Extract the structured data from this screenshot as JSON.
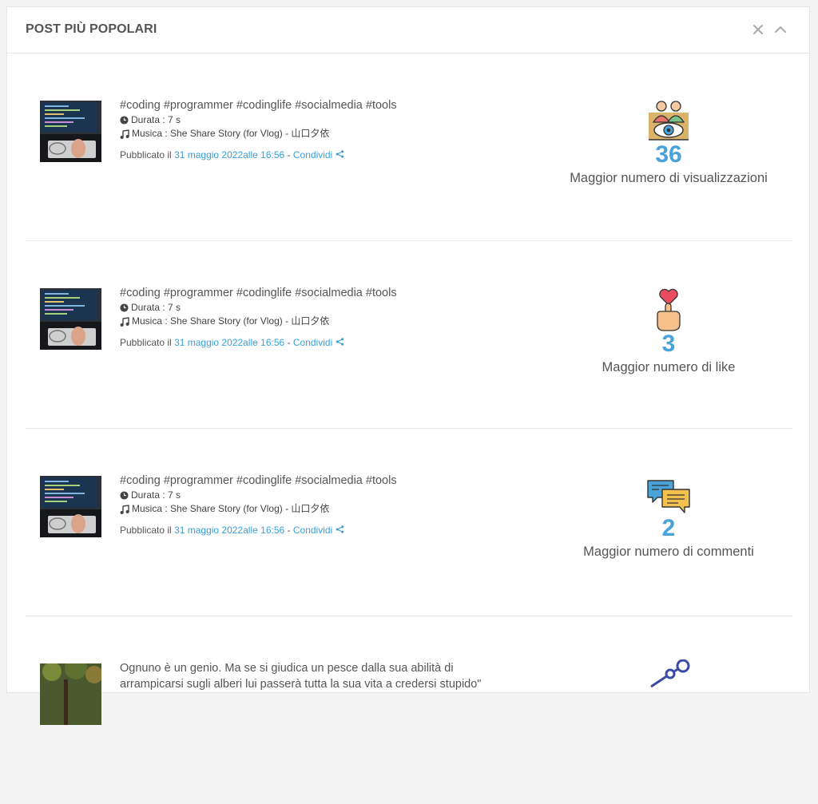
{
  "panel": {
    "title": "POST PIÙ POPOLARI",
    "close_icon": "close-icon",
    "collapse_icon": "chevron-up-icon"
  },
  "posts": [
    {
      "caption": "#coding #programmer #codinglife #socialmedia #tools",
      "duration": "Durata : 7 s",
      "music": "Musica : She Share Story (for Vlog) - 山口夕依",
      "published_prefix": "Pubblicato il",
      "published_date": "31 maggio 2022alle 16:56",
      "separator": "-",
      "share_label": "Condividi",
      "stat_value": "36",
      "stat_label": "Maggior numero di visualizzazioni",
      "stat_icon": "audience-eye-icon"
    },
    {
      "caption": "#coding #programmer #codinglife #socialmedia #tools",
      "duration": "Durata : 7 s",
      "music": "Musica : She Share Story (for Vlog) - 山口夕依",
      "published_prefix": "Pubblicato il",
      "published_date": "31 maggio 2022alle 16:56",
      "separator": "-",
      "share_label": "Condividi",
      "stat_value": "3",
      "stat_label": "Maggior numero di like",
      "stat_icon": "heart-hand-icon"
    },
    {
      "caption": "#coding #programmer #codinglife #socialmedia #tools",
      "duration": "Durata : 7 s",
      "music": "Musica : She Share Story (for Vlog) - 山口夕依",
      "published_prefix": "Pubblicato il",
      "published_date": "31 maggio 2022alle 16:56",
      "separator": "-",
      "share_label": "Condividi",
      "stat_value": "2",
      "stat_label": "Maggior numero di commenti",
      "stat_icon": "comments-icon"
    },
    {
      "caption": "Ognuno è un genio. Ma se si giudica un pesce dalla sua abilità di arrampicarsi sugli alberi lui passerà tutta la sua vita a credersi stupido\"",
      "stat_icon": "share-graph-icon"
    }
  ],
  "colors": {
    "accent": "#4aa3d8",
    "link": "#3aa0d6",
    "text": "#555555",
    "border": "#e6e6e6"
  }
}
